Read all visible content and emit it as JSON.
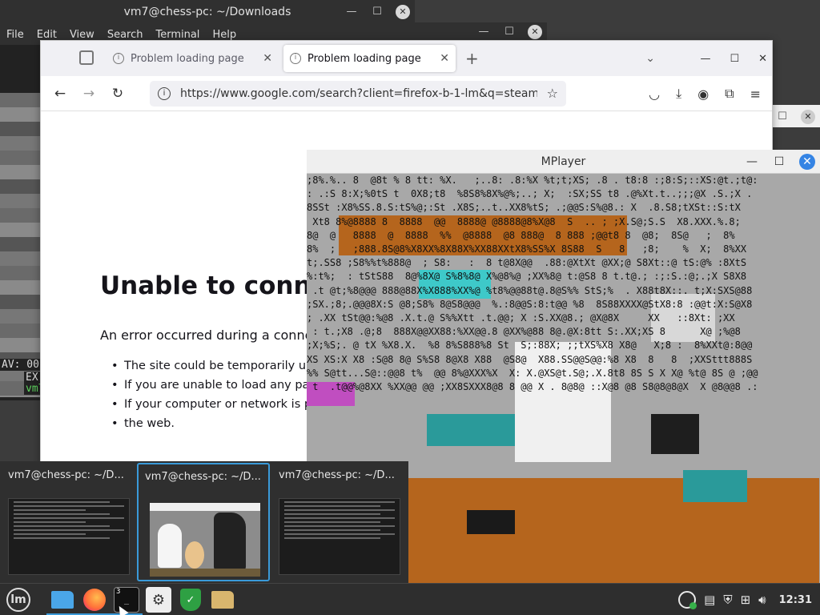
{
  "terminal": {
    "title": "vm7@chess-pc: ~/Downloads",
    "menu": [
      "File",
      "Edit",
      "View",
      "Search",
      "Terminal",
      "Help"
    ],
    "lines": [
      "AV: 00",
      "EX",
      "vm7"
    ]
  },
  "firefox": {
    "tabs": [
      {
        "label": "Problem loading page",
        "active": false
      },
      {
        "label": "Problem loading page",
        "active": true
      }
    ],
    "url": "https://www.google.com/search?client=firefox-b-1-lm&q=steam",
    "error_title": "Unable to conne",
    "error_subtitle": "An error occurred during a conne",
    "error_items": [
      "The site could be temporarily unav",
      "If you are unable to load any page",
      "If your computer or network is pro",
      "the web."
    ]
  },
  "mplayer": {
    "title": "MPlayer",
    "ascii_rows": [
      ";8%.%.. 8  @8t % 8 tt: %X.   ;..8: .8:%X %t;t;XS; .8 . t8:8 :;8:S;::XS:@t.;t@:",
      ": .:S 8:X;%0tS t  0X8;t8  %8S8%8X%@%;..; X;  :SX;SS t8 .@%Xt.t..;;;@X .S.;X .",
      "8SSt :X8%SS.8.S:tS%@;:St .X8S;..t..XX8%tS; .;@@S:S%@8.: X  .8.S8;tXSt::S:tX",
      " Xt8 8%@8888 8  8888  @@  8888@ @8888@8%X@8  S  .. ; ;X.S@;S.S  X8.XXX.%.8;",
      "8@  @   8888  @  8888  %%  @8888  @8 888@  8 888 ;@@t8 8  @8;  8S@   ;  8%",
      "8%  ;   ;888.8S@8%X8XX%8X88X%XX88XXtX8%SS%X 8S88  S   8   ;8;    %  X;  8%XX",
      "t;.SS8 ;S8%%t%888@  ; S8:   :  8 t@8X@@  .88:@XtXt @XX;@ S8Xt::@ tS:@% :8XtS",
      "%:t%;  : tStS88  8@%8X@ S%8%8@ X%@8%@ ;XX%8@ t:@S8 8 t.t@.; :;:S.:@;.;X S8X8",
      " .t @t;%8@@@ 888@88X%X888%XX%@ %t8%@@88t@.8@S%% StS;%  . X88t8X::. t;X:SXS@88",
      ";SX.;8;.@@@8X:S @8;S8% 8@S8@@@  %.:8@@S:8:t@@ %8  8S88XXXX@StX8:8 :@@t:X:S@X8",
      "; .XX tSt@@:%@8 .X.t.@ S%%Xtt .t.@@; X :S.XX@8.; @X@8X     XX   ::8Xt: ;XX",
      " : t.;X8 .@;8  888X@@XX88:%XX@@.8 @XX%@88 8@.@X:8tt S:.XX;XS 8      X@ ;%@8",
      ";X;%S;. @ tX %X8.X.  %8 8%S888%8 St  S;:88X; ;;tXS%X8 X8@   X;8 :  8%XXt@:8@@",
      "XS XS:X X8 :S@8 8@ S%S8 8@X8 X88  @S8@  X88.SS@@S@@:%8 X8  8   8  ;XXSttt888S",
      "%% S@tt...S@::@@8 t%  @@ 8%@XXX%X  X: X.@XS@t.S@;.X.8t8 8S S X X@ %t@ 8S @ ;@@",
      " t  .t@@%@8XX %XX@@ @@ ;XX8SXXX8@8 8 @@ X . 8@8@ ::X@8 @8 S8@8@8@X  X @8@@8 .:"
    ]
  },
  "switcher": {
    "items": [
      {
        "label": "vm7@chess-pc: ~/D...",
        "active": false
      },
      {
        "label": "vm7@chess-pc: ~/D...",
        "active": true
      },
      {
        "label": "vm7@chess-pc: ~/D...",
        "active": false
      }
    ]
  },
  "taskbar": {
    "terminal_badge": "3",
    "clock": "12:31"
  }
}
